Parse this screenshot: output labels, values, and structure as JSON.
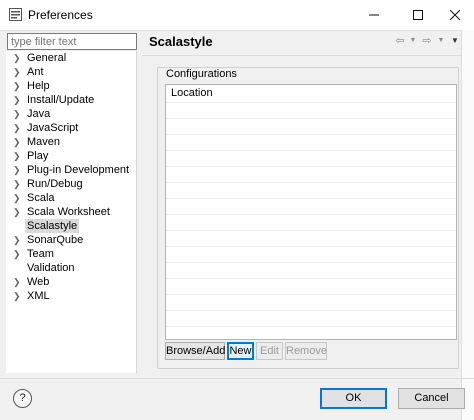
{
  "window": {
    "title": "Preferences"
  },
  "filter": {
    "placeholder": "type filter text"
  },
  "tree": {
    "items": [
      {
        "label": "General",
        "expandable": true
      },
      {
        "label": "Ant",
        "expandable": true
      },
      {
        "label": "Help",
        "expandable": true
      },
      {
        "label": "Install/Update",
        "expandable": true
      },
      {
        "label": "Java",
        "expandable": true
      },
      {
        "label": "JavaScript",
        "expandable": true
      },
      {
        "label": "Maven",
        "expandable": true
      },
      {
        "label": "Play",
        "expandable": true
      },
      {
        "label": "Plug-in Development",
        "expandable": true
      },
      {
        "label": "Run/Debug",
        "expandable": true
      },
      {
        "label": "Scala",
        "expandable": true
      },
      {
        "label": "Scala Worksheet",
        "expandable": true
      },
      {
        "label": "Scalastyle",
        "expandable": false,
        "selected": true
      },
      {
        "label": "SonarQube",
        "expandable": true
      },
      {
        "label": "Team",
        "expandable": true
      },
      {
        "label": "Validation",
        "expandable": false
      },
      {
        "label": "Web",
        "expandable": true
      },
      {
        "label": "XML",
        "expandable": true
      }
    ]
  },
  "page": {
    "title": "Scalastyle",
    "group_label": "Configurations",
    "table": {
      "column_header": "Location",
      "rows": []
    },
    "buttons": {
      "browse_add": "Browse/Add",
      "new": "New",
      "edit": "Edit",
      "remove": "Remove"
    }
  },
  "footer": {
    "help": "?",
    "ok": "OK",
    "cancel": "Cancel"
  },
  "colors": {
    "focus": "#0078d7",
    "selection": "#d9d9d9"
  }
}
